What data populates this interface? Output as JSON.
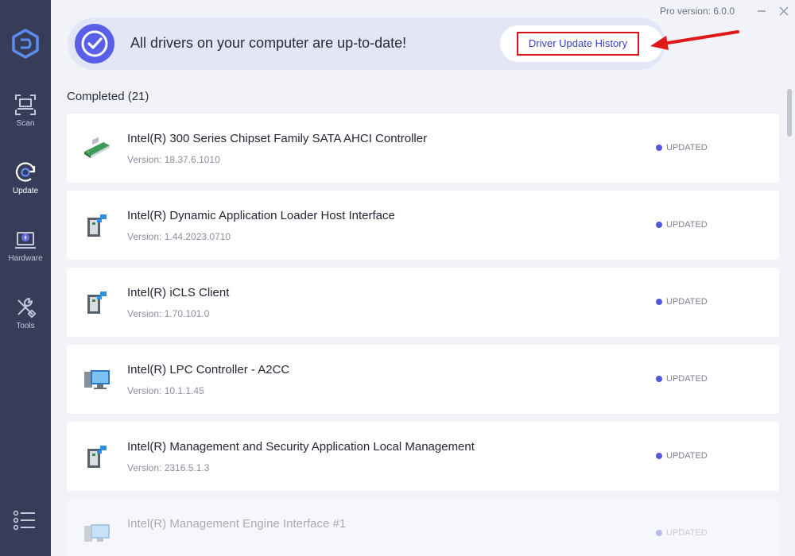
{
  "app": {
    "pro_version": "Pro version: 6.0.0",
    "logo_icon": "driver-easy-logo-icon"
  },
  "sidebar": {
    "items": [
      {
        "label": "Scan",
        "icon": "scan-icon",
        "active": false
      },
      {
        "label": "Update",
        "icon": "update-icon",
        "active": true
      },
      {
        "label": "Hardware",
        "icon": "hardware-icon",
        "active": false
      },
      {
        "label": "Tools",
        "icon": "tools-icon",
        "active": false
      }
    ],
    "menu_icon": "menu-list-icon"
  },
  "banner": {
    "message": "All drivers on your computer are up-to-date!",
    "history_link": "Driver Update History",
    "highlight_color": "#d8121a",
    "accent_color": "#5b5fe8"
  },
  "section": {
    "title": "Completed (21)"
  },
  "drivers": [
    {
      "name": "Intel(R) 300 Series Chipset Family SATA AHCI Controller",
      "version": "Version: 18.37.6.1010",
      "status": "UPDATED",
      "icon": "storage-controller-icon"
    },
    {
      "name": "Intel(R) Dynamic Application Loader Host Interface",
      "version": "Version: 1.44.2023.0710",
      "status": "UPDATED",
      "icon": "system-device-icon"
    },
    {
      "name": "Intel(R) iCLS Client",
      "version": "Version: 1.70.101.0",
      "status": "UPDATED",
      "icon": "system-device-icon"
    },
    {
      "name": "Intel(R) LPC Controller - A2CC",
      "version": "Version: 10.1.1.45",
      "status": "UPDATED",
      "icon": "computer-icon"
    },
    {
      "name": "Intel(R) Management and Security Application Local Management",
      "version": "Version: 2316.5.1.3",
      "status": "UPDATED",
      "icon": "system-device-icon"
    },
    {
      "name": "Intel(R) Management Engine Interface #1",
      "version": "",
      "status": "UPDATED",
      "icon": "computer-icon"
    }
  ]
}
